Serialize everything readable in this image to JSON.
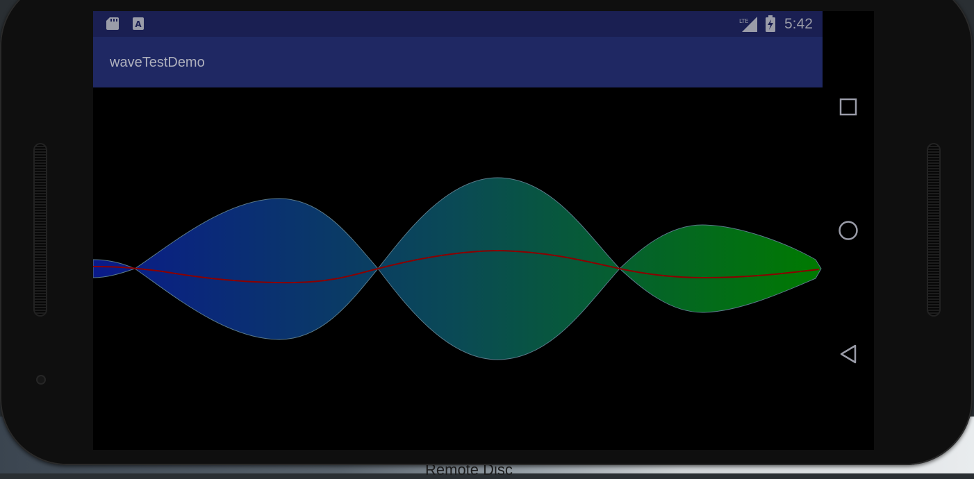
{
  "app": {
    "title": "waveTestDemo"
  },
  "status_bar": {
    "time": "5:42",
    "network": "LTE",
    "icons": [
      "sd-card-icon",
      "keyboard-a-icon",
      "lte-signal-icon",
      "battery-charging-icon"
    ]
  },
  "navigation": {
    "buttons": [
      "recents-square-icon",
      "home-circle-icon",
      "back-triangle-icon"
    ]
  },
  "desktop": {
    "partial_text": "Remote Disc"
  },
  "colors": {
    "status_bar": "#1a1f52",
    "app_bar": "#1f2863",
    "wave_start": "#0a1a8a",
    "wave_mid": "#0a4a55",
    "wave_end": "#007a00",
    "center_line": "#8b0000"
  }
}
